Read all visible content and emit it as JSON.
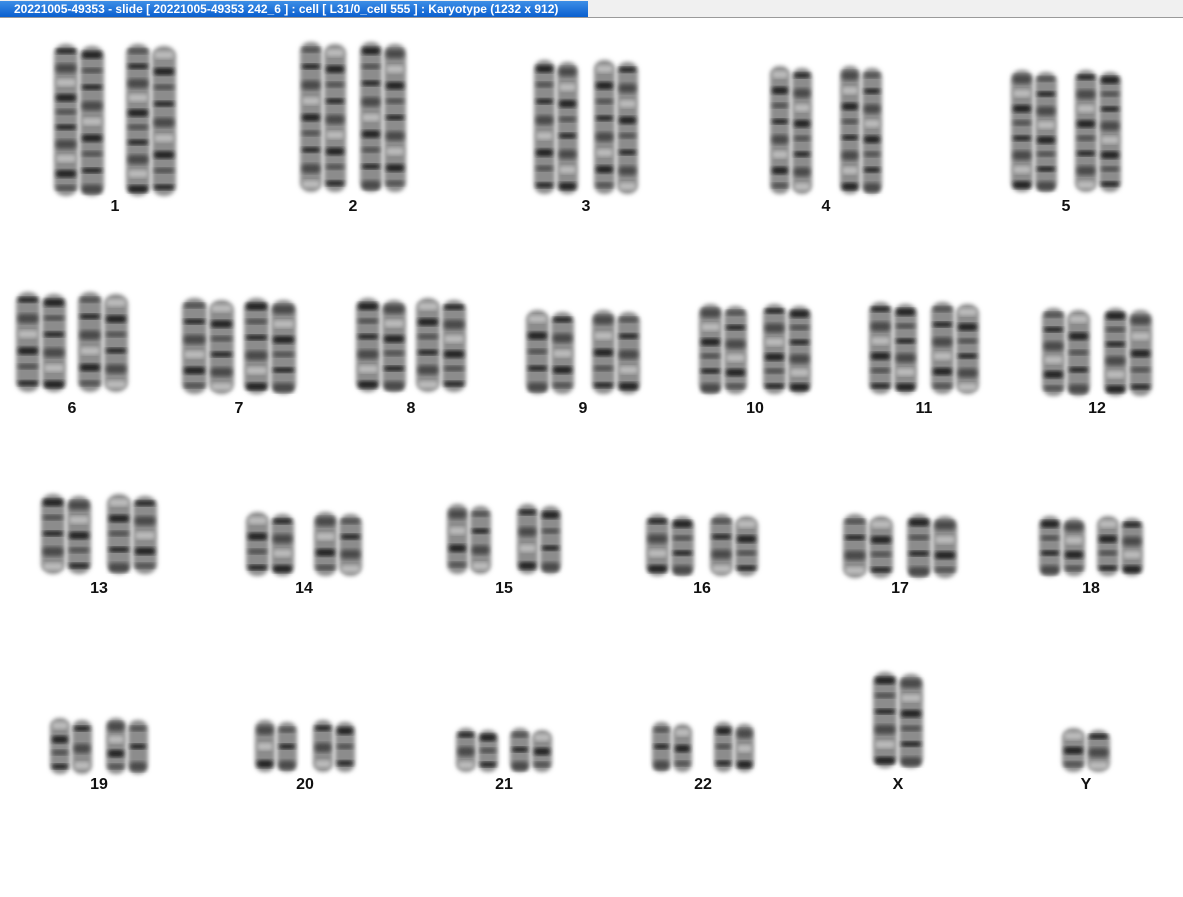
{
  "window": {
    "title": "20221005-49353 - slide [ 20221005-49353 242_6 ] : cell [ L31/0_cell 555 ] : Karyotype  (1232 x 912)"
  },
  "karyotype": {
    "chromosomes": [
      {
        "label": "1"
      },
      {
        "label": "2"
      },
      {
        "label": "3"
      },
      {
        "label": "4"
      },
      {
        "label": "5"
      },
      {
        "label": "6"
      },
      {
        "label": "7"
      },
      {
        "label": "8"
      },
      {
        "label": "9"
      },
      {
        "label": "10"
      },
      {
        "label": "11"
      },
      {
        "label": "12"
      },
      {
        "label": "13"
      },
      {
        "label": "14"
      },
      {
        "label": "15"
      },
      {
        "label": "16"
      },
      {
        "label": "17"
      },
      {
        "label": "18"
      },
      {
        "label": "19"
      },
      {
        "label": "20"
      },
      {
        "label": "21"
      },
      {
        "label": "22"
      },
      {
        "label": "X"
      },
      {
        "label": "Y"
      }
    ]
  }
}
